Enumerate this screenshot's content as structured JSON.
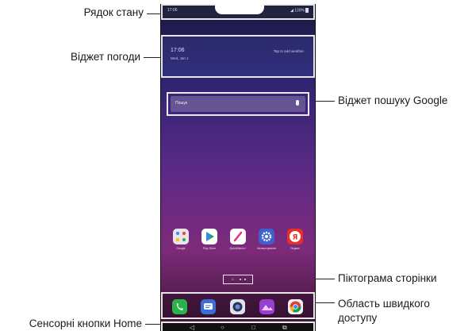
{
  "callouts": {
    "status_bar": "Рядок стану",
    "weather_widget": "Віджет погоди",
    "google_search_widget": "Віджет пошуку Google",
    "page_icon": "Піктограма сторінки",
    "quick_access_line1": "Область швидкого",
    "quick_access_line2": "доступу",
    "home_touch_buttons": "Сенсорні кнопки Home"
  },
  "phone": {
    "status_bar": {
      "time": "17:06",
      "right": "◢ 100%"
    },
    "weather": {
      "time": "17:06",
      "date": "Wed, Jan 1",
      "hint": "Tap to add weather"
    },
    "search": {
      "placeholder": "Пошук",
      "mic_icon": "microphone-icon"
    },
    "home_apps": [
      {
        "label": "Google",
        "icon": "google-folder-icon"
      },
      {
        "label": "Play Store",
        "icon": "play-store-icon"
      },
      {
        "label": "QuickMemo+",
        "icon": "quickmemo-icon"
      },
      {
        "label": "Налаштування",
        "icon": "settings-icon"
      },
      {
        "label": "Яндекс",
        "icon": "yandex-icon"
      }
    ],
    "page_indicator": {
      "home_glyph": "⌂",
      "dots": 2
    },
    "dock_apps": [
      {
        "icon": "phone-icon",
        "color": "#2bb34a"
      },
      {
        "icon": "messages-icon",
        "color": "#3a6fd8"
      },
      {
        "icon": "camera-icon",
        "color": "#3a4a7a"
      },
      {
        "icon": "gallery-icon",
        "color": "#9a3ed0"
      },
      {
        "icon": "chrome-icon",
        "color": "#f2f2f2"
      }
    ],
    "nav_buttons": [
      {
        "icon": "back-icon",
        "glyph": "◁"
      },
      {
        "icon": "home-icon",
        "glyph": "○"
      },
      {
        "icon": "overview-icon",
        "glyph": "□"
      },
      {
        "icon": "dual-window-icon",
        "glyph": "⧉"
      }
    ]
  }
}
